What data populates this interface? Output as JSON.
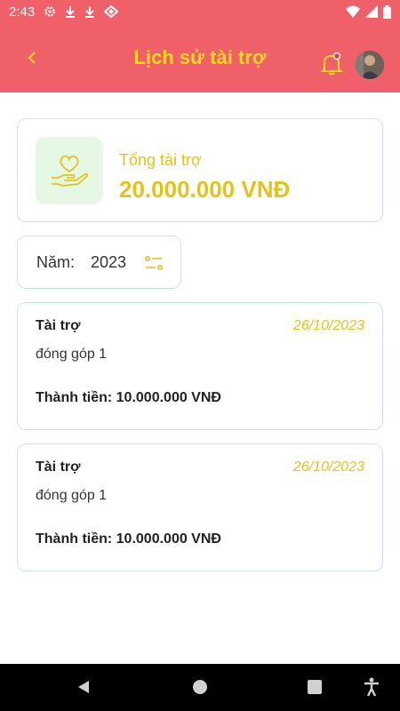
{
  "status_bar": {
    "time": "2:43"
  },
  "header": {
    "title": "Lịch sử tài trợ"
  },
  "summary": {
    "label": "Tổng tài trợ",
    "value": "20.000.000 VNĐ"
  },
  "year_filter": {
    "label": "Năm:",
    "value": "2023"
  },
  "donations": [
    {
      "type": "Tài trợ",
      "date": "26/10/2023",
      "description": "đóng góp 1",
      "amount": "Thành tiền: 10.000.000 VNĐ"
    },
    {
      "type": "Tài trợ",
      "date": "26/10/2023",
      "description": "đóng góp 1",
      "amount": "Thành tiền: 10.000.000 VNĐ"
    }
  ],
  "colors": {
    "primary": "#ef6068",
    "accent": "#e2c31c",
    "title": "#f2d81d",
    "card_border": "#cfe3ee",
    "icon_bg": "#e4f8e4"
  }
}
